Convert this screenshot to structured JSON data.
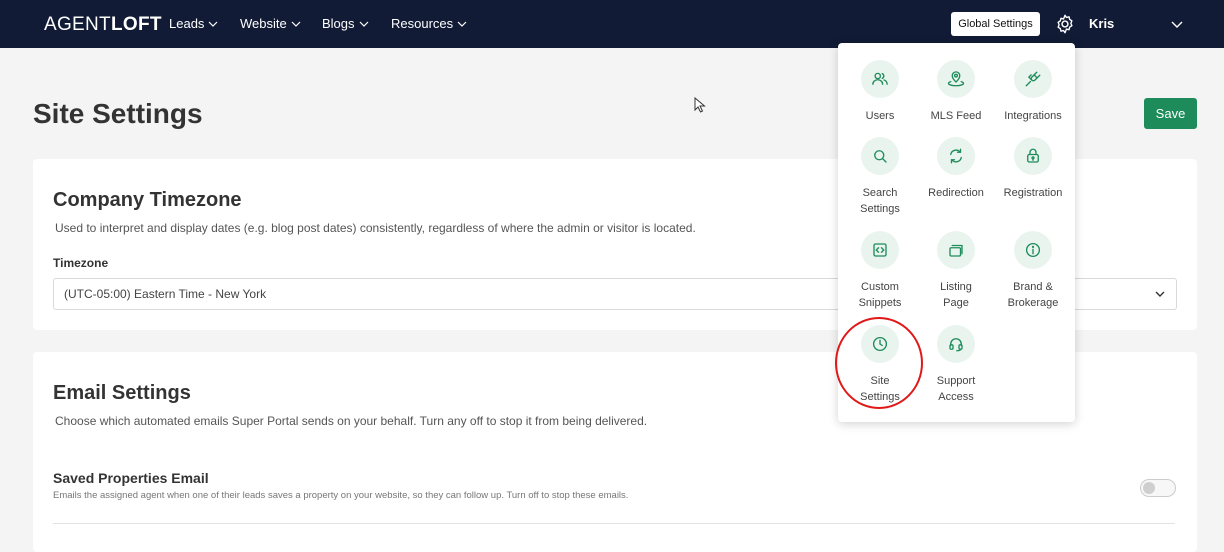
{
  "nav": {
    "logo_light": "AGENT",
    "logo_bold": "LOFT",
    "items": [
      "Leads",
      "Website",
      "Blogs",
      "Resources"
    ],
    "global_settings": "Global Settings",
    "user": "Kris"
  },
  "page": {
    "title": "Site Settings",
    "save": "Save"
  },
  "timezone_card": {
    "title": "Company Timezone",
    "desc": "Used to interpret and display dates (e.g. blog post dates) consistently, regardless of where the admin or visitor is located.",
    "field_label": "Timezone",
    "value": "(UTC-05:00) Eastern Time - New York"
  },
  "email_card": {
    "title": "Email Settings",
    "desc": "Choose which automated emails Super Portal sends on your behalf. Turn any off to stop it from being delivered.",
    "row_title": "Saved Properties Email",
    "row_desc": "Emails the assigned agent when one of their leads saves a property on your website, so they can follow up. Turn off to stop these emails.",
    "toggle_on": false
  },
  "dropdown": {
    "items": [
      {
        "label_1": "Users",
        "label_2": "",
        "icon": "users-icon"
      },
      {
        "label_1": "MLS Feed",
        "label_2": "",
        "icon": "map-pin-icon"
      },
      {
        "label_1": "Integrations",
        "label_2": "",
        "icon": "plug-icon"
      },
      {
        "label_1": "Search",
        "label_2": "Settings",
        "icon": "search-icon"
      },
      {
        "label_1": "Redirection",
        "label_2": "",
        "icon": "refresh-icon"
      },
      {
        "label_1": "Registration",
        "label_2": "",
        "icon": "lock-icon"
      },
      {
        "label_1": "Custom",
        "label_2": "Snippets",
        "icon": "code-icon"
      },
      {
        "label_1": "Listing",
        "label_2": "Page",
        "icon": "cards-icon"
      },
      {
        "label_1": "Brand &",
        "label_2": "Brokerage",
        "icon": "info-icon"
      },
      {
        "label_1": "Site",
        "label_2": "Settings",
        "icon": "clock-icon"
      },
      {
        "label_1": "Support",
        "label_2": "Access",
        "icon": "headset-icon"
      }
    ]
  },
  "colors": {
    "nav_bg": "#111b35",
    "accent": "#1e8c5a",
    "highlight": "#e01818"
  }
}
